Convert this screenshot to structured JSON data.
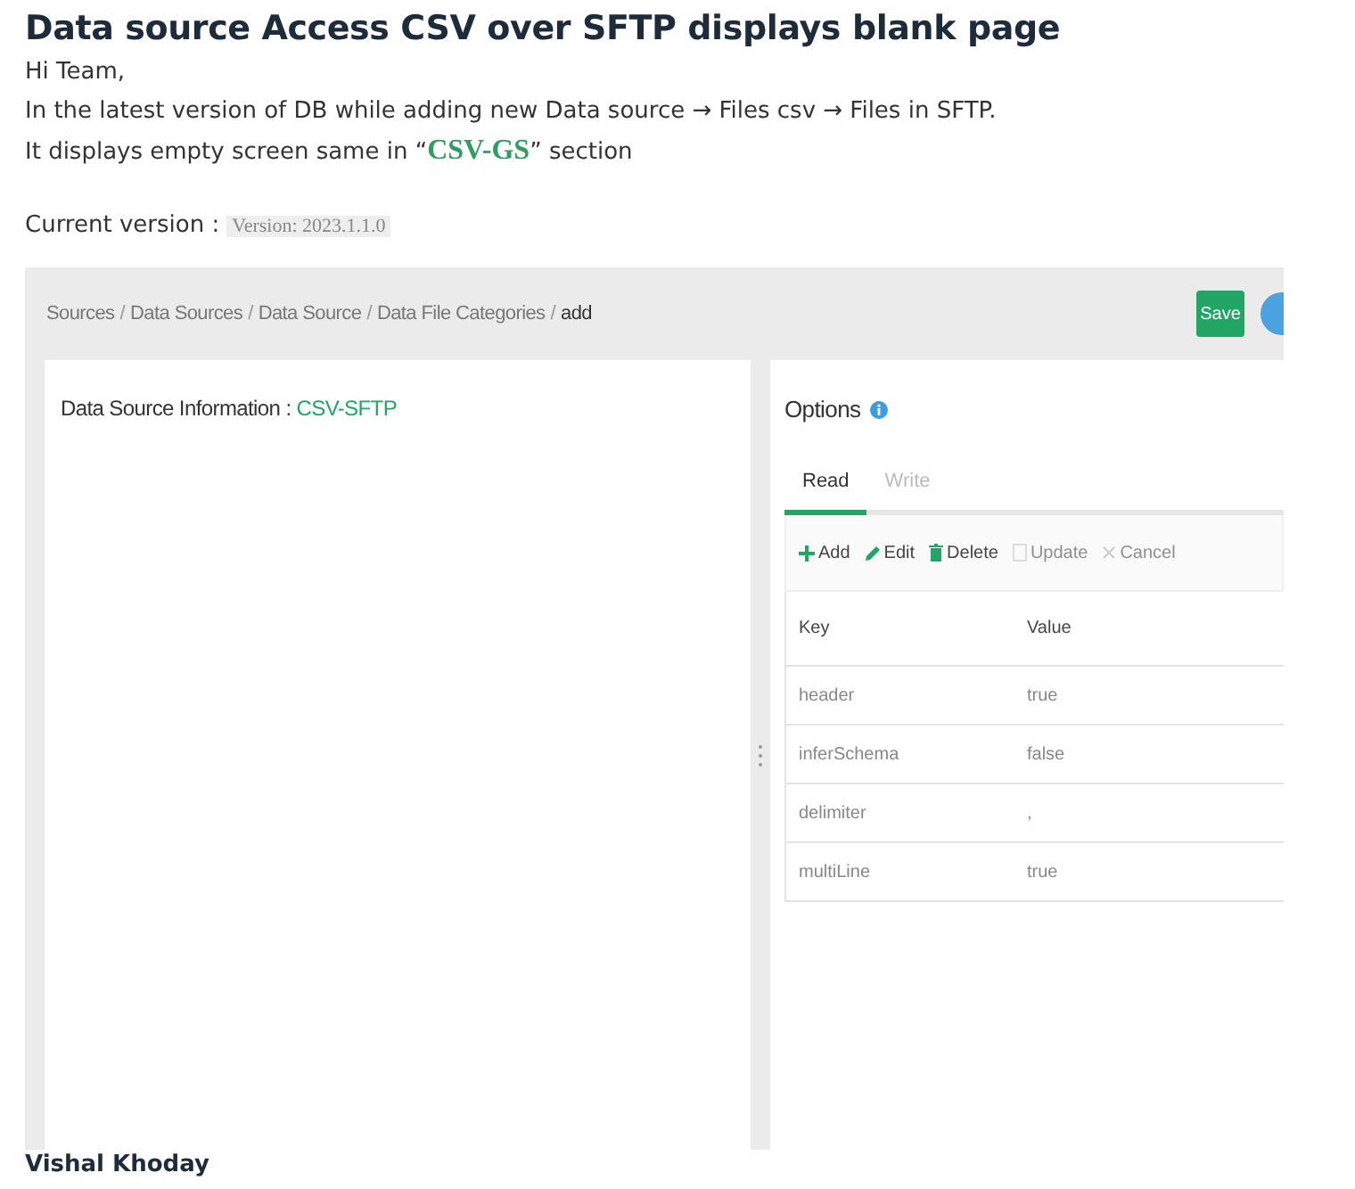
{
  "post": {
    "title": "Data source Access CSV over SFTP displays blank page",
    "paragraphs": [
      "Hi Team,",
      "In the latest version of DB while adding new Data source → Files csv → Files in SFTP.",
      "It displays empty screen same in “**CSV-GS**” section"
    ],
    "version_label": "Current version :",
    "version": "Version: 2023.1.1.0",
    "author": "Vishal Khoday"
  },
  "screenshot": {
    "breadcrumb": [
      {
        "label": "Sources",
        "selected": false
      },
      {
        "label": "Data Sources",
        "selected": false
      },
      {
        "label": "Data Source",
        "selected": false
      },
      {
        "label": "Data File Categories",
        "selected": false
      },
      {
        "label": "add",
        "selected": true
      }
    ],
    "breadcrumb_separator": "/",
    "save_button": "Save",
    "info_label": "Data Source Information :",
    "info_value": "CSV-SFTP",
    "options_title": "Options",
    "tabs": [
      {
        "label": "Read",
        "selected": true
      },
      {
        "label": "Write",
        "selected": false
      }
    ],
    "toolbar": [
      {
        "kind": "add",
        "label": "Add",
        "disabled": false
      },
      {
        "kind": "edit",
        "label": "Edit",
        "disabled": false
      },
      {
        "kind": "delete",
        "label": "Delete",
        "disabled": false
      },
      {
        "kind": "update",
        "label": "Update",
        "disabled": true
      },
      {
        "kind": "cancel",
        "label": "Cancel",
        "disabled": true
      }
    ],
    "table": {
      "columns": [
        "Key",
        "Value"
      ],
      "rows": [
        [
          "header",
          "true"
        ],
        [
          "inferSchema",
          "false"
        ],
        [
          "delimiter",
          ","
        ],
        [
          "multiLine",
          "true"
        ]
      ]
    }
  }
}
